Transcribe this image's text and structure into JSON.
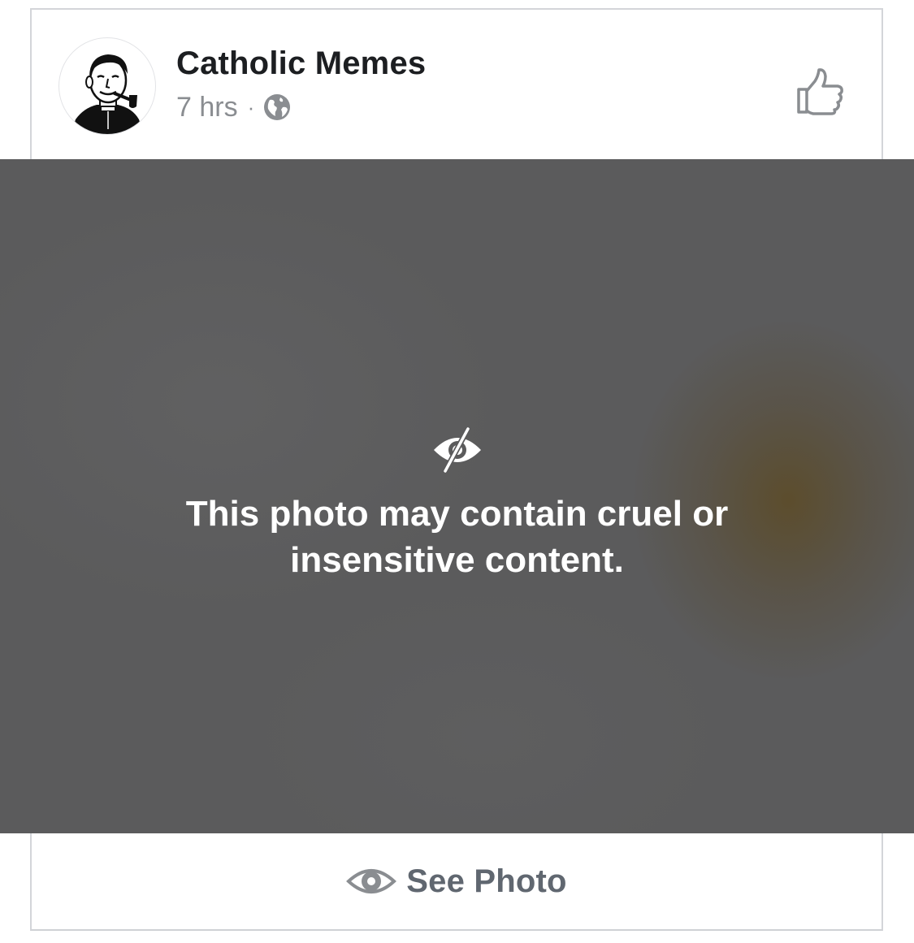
{
  "post": {
    "page_name": "Catholic Memes",
    "timestamp": "7 hrs",
    "separator": "·",
    "audience_icon": "globe-icon",
    "avatar_description_icon": "priest-with-pipe-avatar",
    "like_icon": "thumbs-up-icon"
  },
  "photo": {
    "warning_icon": "eye-slash-icon",
    "warning_text": "This photo may contain cruel or insensitive content."
  },
  "see_photo": {
    "icon": "eye-icon",
    "label": "See Photo"
  },
  "colors": {
    "overlay": "#5b5b5c",
    "meta_text": "#8a8d91",
    "name_text": "#1c1e21",
    "button_text": "#606770"
  }
}
